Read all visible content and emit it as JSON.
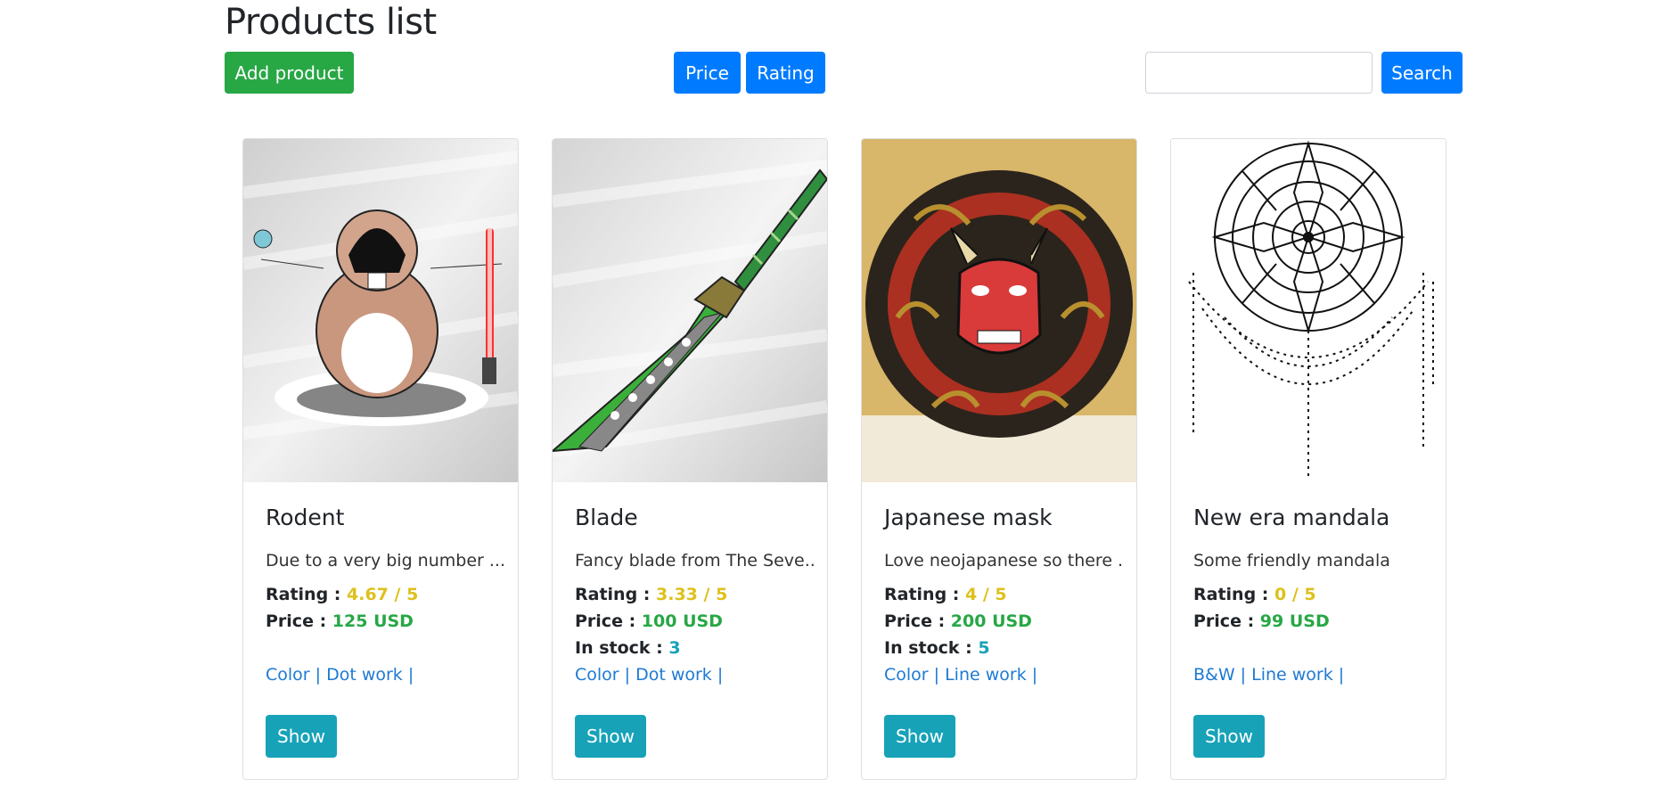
{
  "header": {
    "title": "Products list",
    "add_label": "Add product",
    "price_label": "Price",
    "rating_label": "Rating",
    "search_placeholder": "",
    "search_label": "Search"
  },
  "labels": {
    "rating": "Rating :",
    "price": "Price :",
    "stock": "In stock :",
    "show": "Show"
  },
  "products": [
    {
      "name": "Rodent",
      "desc": "Due to a very big number ...",
      "rating": "4.67 / 5",
      "price": "125 USD",
      "stock": "",
      "tags": "Color | Dot work |",
      "image": "hamster-with-lightsaber-image"
    },
    {
      "name": "Blade",
      "desc": "Fancy blade from The Seve...",
      "rating": "3.33 / 5",
      "price": "100 USD",
      "stock": "3",
      "tags": "Color | Dot work |",
      "image": "green-blade-image"
    },
    {
      "name": "Japanese mask",
      "desc": "Love neojapanese so there ...",
      "rating": "4 / 5",
      "price": "200 USD",
      "stock": "5",
      "tags": "Color | Line work |",
      "image": "oni-mask-image"
    },
    {
      "name": "New era mandala",
      "desc": "Some friendly mandala",
      "rating": "0 / 5",
      "price": "99 USD",
      "stock": "",
      "tags": "B&W | Line work |",
      "image": "mandala-image"
    }
  ],
  "colors": {
    "green": "#28a745",
    "blue": "#007bff",
    "teal": "#17a2b8",
    "yellow": "#ddc11d",
    "link": "#1e7ad3"
  }
}
